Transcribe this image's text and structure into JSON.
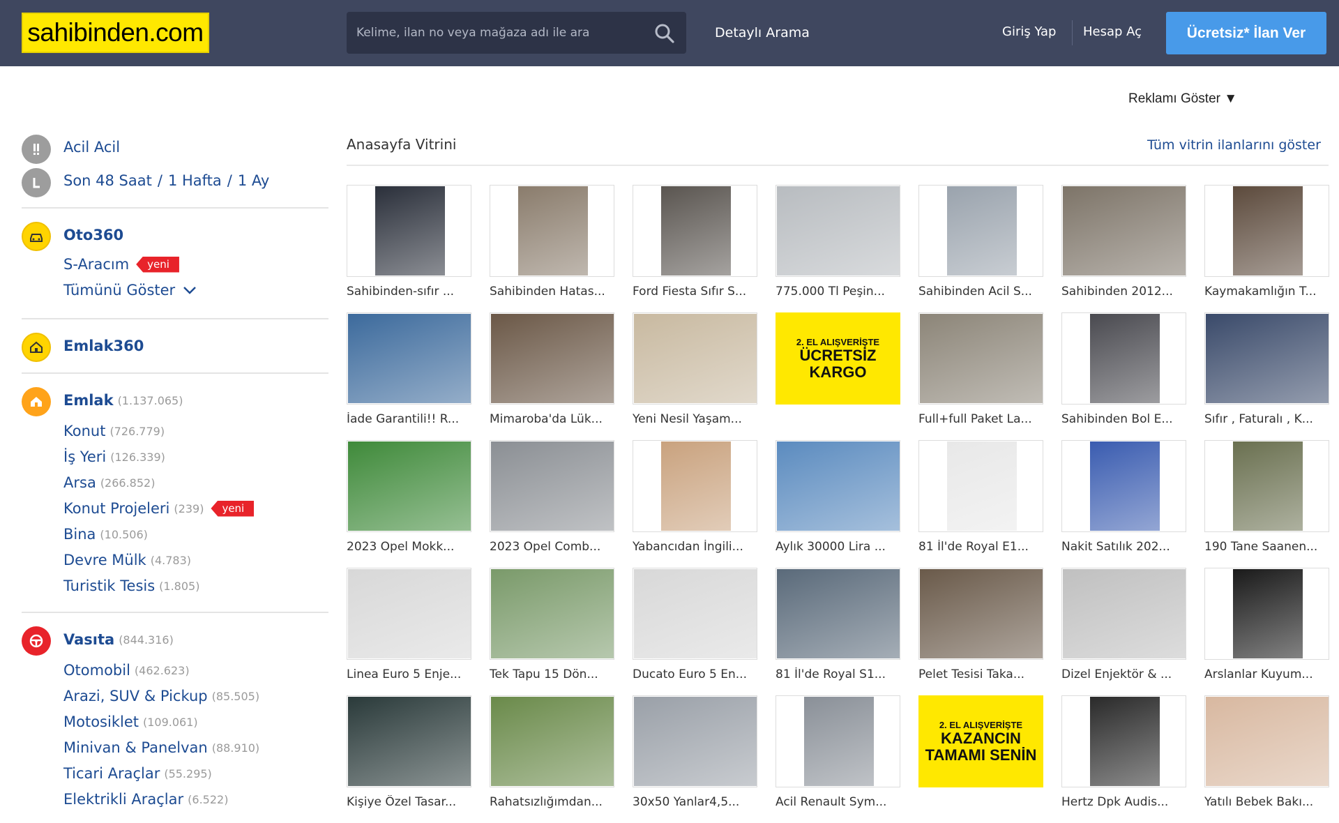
{
  "header": {
    "logo": "sahibinden.com",
    "search_placeholder": "Kelime, ilan no veya mağaza adı ile ara",
    "detailed_search": "Detaylı Arama",
    "login": "Giriş Yap",
    "register": "Hesap Aç",
    "cta": "Ücretsiz* İlan Ver",
    "brand_color": "#ffe800",
    "bar_color": "#3f475f",
    "cta_color": "#489ae9"
  },
  "ad_toggle": "Reklamı Göster ▼",
  "sidebar": {
    "urgent": "Acil Acil",
    "recent": [
      "Son 48 Saat",
      "1 Hafta",
      "1 Ay"
    ],
    "oto360": "Oto360",
    "s_aracim": "S-Aracım",
    "show_all": "Tümünü Göster",
    "new_badge": "yeni",
    "emlak360": "Emlak360",
    "emlak": {
      "label": "Emlak",
      "count": "(1.137.065)"
    },
    "emlak_items": [
      {
        "label": "Konut",
        "count": "(726.779)"
      },
      {
        "label": "İş Yeri",
        "count": "(126.339)"
      },
      {
        "label": "Arsa",
        "count": "(266.852)"
      },
      {
        "label": "Konut Projeleri",
        "count": "(239)"
      },
      {
        "label": "Bina",
        "count": "(10.506)"
      },
      {
        "label": "Devre Mülk",
        "count": "(4.783)"
      },
      {
        "label": "Turistik Tesis",
        "count": "(1.805)"
      }
    ],
    "vasita": {
      "label": "Vasıta",
      "count": "(844.316)"
    },
    "vasita_items": [
      {
        "label": "Otomobil",
        "count": "(462.623)"
      },
      {
        "label": "Arazi, SUV & Pickup",
        "count": "(85.505)"
      },
      {
        "label": "Motosiklet",
        "count": "(109.061)"
      },
      {
        "label": "Minivan & Panelvan",
        "count": "(88.910)"
      },
      {
        "label": "Ticari Araçlar",
        "count": "(55.295)"
      },
      {
        "label": "Elektrikli Araçlar",
        "count": "(6.522)"
      }
    ]
  },
  "vitrin": {
    "title": "Anasayfa Vitrini",
    "show_all": "Tüm vitrin ilanlarını göster",
    "items": [
      {
        "caption": "Sahibinden-sıfır ...",
        "img": "car-dark",
        "color": "#2a2f3a"
      },
      {
        "caption": "Sahibinden Hatas...",
        "img": "car-white",
        "color": "#8a7c6c"
      },
      {
        "caption": "Ford Fiesta Sıfır S...",
        "img": "engine",
        "color": "#5a5550"
      },
      {
        "caption": "775.000 Tl Peşin...",
        "img": "suv-white",
        "color": "#b8bcc0"
      },
      {
        "caption": "Sahibinden Acil S...",
        "img": "car-white-front",
        "color": "#9aa3ad"
      },
      {
        "caption": "Sahibinden 2012...",
        "img": "car-white-street",
        "color": "#7d7468"
      },
      {
        "caption": "Kaymakamlığın T...",
        "img": "living-room",
        "color": "#5c4a3c"
      },
      {
        "caption": "İade Garantili!! R...",
        "img": "forklift",
        "color": "#3c6a9c"
      },
      {
        "caption": "Mimaroba'da Lük...",
        "img": "apartment",
        "color": "#6b5847"
      },
      {
        "caption": "Yeni Nesil Yaşam...",
        "img": "interior",
        "color": "#c8b9a0"
      },
      {
        "caption": "",
        "img": "promo-kargo",
        "promo_l1": "2. EL ALIŞVERİŞTE",
        "promo_l2": "ÜCRETSİZ KARGO"
      },
      {
        "caption": "Full+full Paket La...",
        "img": "hatchback",
        "color": "#8c8578"
      },
      {
        "caption": "Sahibinden Bol E...",
        "img": "motorcycle",
        "color": "#4a4a50"
      },
      {
        "caption": "Sıfır , Faturalı , K...",
        "img": "tv-box",
        "color": "#3a4a6a"
      },
      {
        "caption": "2023 Opel Mokk...",
        "img": "opel-mokka",
        "color": "#3f8a3a"
      },
      {
        "caption": "2023 Opel Comb...",
        "img": "opel-combo",
        "color": "#8b8f94"
      },
      {
        "caption": "Yabancıdan İngili...",
        "img": "beach",
        "color": "#c9a27e"
      },
      {
        "caption": "Aylık 30000 Lira ...",
        "img": "villa",
        "color": "#5b8bbf"
      },
      {
        "caption": "81 İl'de Royal E1...",
        "img": "forklift-small",
        "color": "#e8e8e8"
      },
      {
        "caption": "Nakit Satılık 202...",
        "img": "tractor",
        "color": "#3a5cb0"
      },
      {
        "caption": "190 Tane Saanen...",
        "img": "goats",
        "color": "#6a7050"
      },
      {
        "caption": "Linea Euro 5 Enje...",
        "img": "injectors",
        "color": "#d8d8d8"
      },
      {
        "caption": "Tek Tapu 15 Dön...",
        "img": "landscape",
        "color": "#7a9a6a"
      },
      {
        "caption": "Ducato Euro 5 En...",
        "img": "injectors-2",
        "color": "#d8d8d8"
      },
      {
        "caption": "81 İl'de Royal S1...",
        "img": "pallet-truck",
        "color": "#5a6a7a"
      },
      {
        "caption": "Pelet Tesisi Taka...",
        "img": "factory",
        "color": "#6a5a4a"
      },
      {
        "caption": "Dizel Enjektör & ...",
        "img": "injector-parts",
        "color": "#c0c0c0"
      },
      {
        "caption": "Arslanlar Kuyum...",
        "img": "phone-photo",
        "color": "#1a1a1a"
      },
      {
        "caption": "Kişiye Özel Tasar...",
        "img": "boat",
        "color": "#2a3a3a"
      },
      {
        "caption": "Rahatsızlığımdan...",
        "img": "sheep",
        "color": "#6a8a4a"
      },
      {
        "caption": "30x50 Yanlar4,5...",
        "img": "tent",
        "color": "#9aa0a8"
      },
      {
        "caption": "Acil Renault Sym...",
        "img": "renault",
        "color": "#8a9098"
      },
      {
        "caption": "",
        "img": "promo-kazanc",
        "promo_l1": "2. EL ALIŞVERİŞTE",
        "promo_l2": "KAZANCIN TAMAMI SENİN"
      },
      {
        "caption": "Hertz Dpk Audis...",
        "img": "speakers",
        "color": "#2a2a2a"
      },
      {
        "caption": "Yatılı Bebek Bakı...",
        "img": "baby",
        "color": "#d8b8a0"
      }
    ]
  }
}
